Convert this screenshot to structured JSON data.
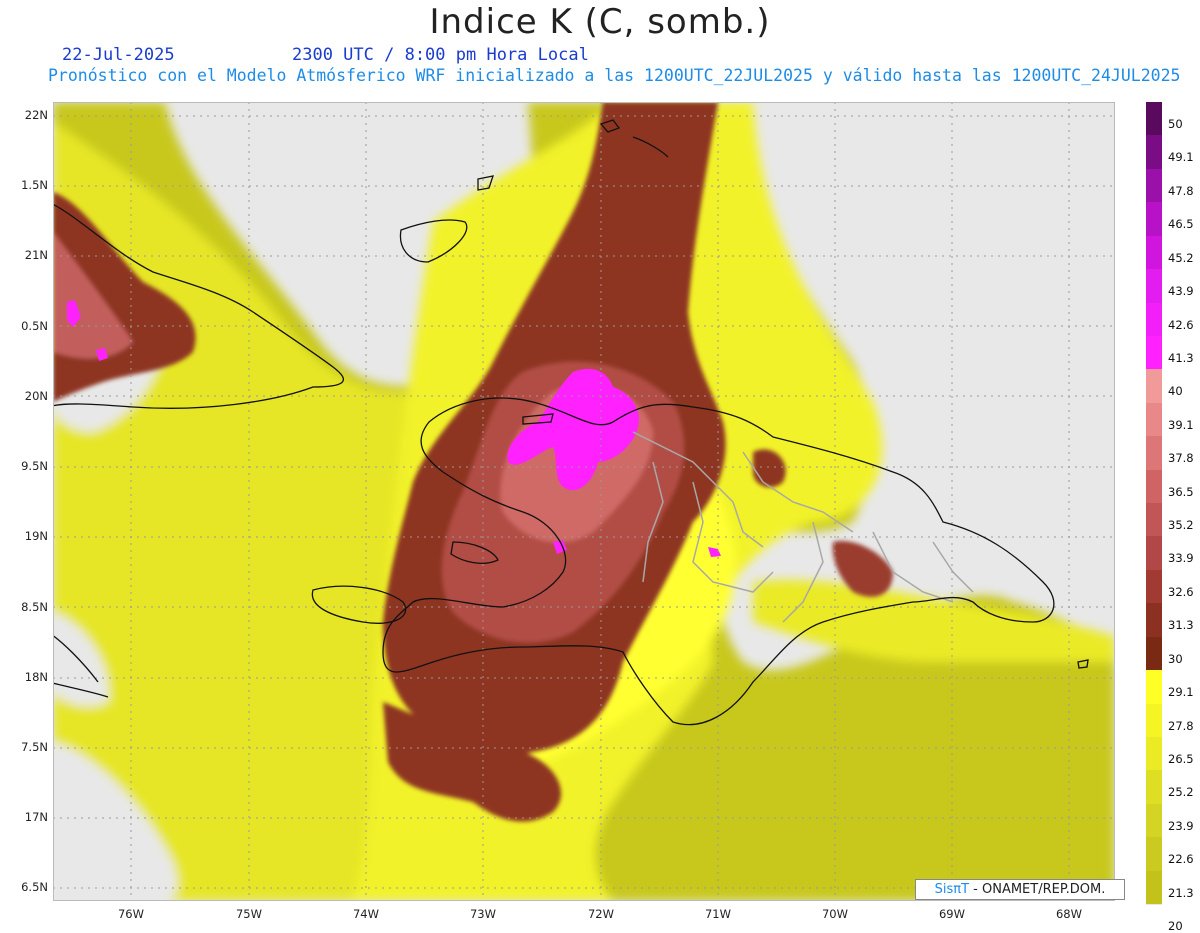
{
  "title": "Indice K (C, somb.)",
  "date": "22-Jul-2025",
  "time_label": "2300 UTC / 8:00 pm Hora Local",
  "subtitle": "Pronóstico con el Modelo Atmósferico WRF inicializado a las 1200UTC_22JUL2025 y válido hasta las  1200UTC_24JUL2025",
  "lat_labels": [
    "22N",
    "1.5N",
    "21N",
    "0.5N",
    "20N",
    "9.5N",
    "19N",
    "8.5N",
    "18N",
    "7.5N",
    "17N",
    "6.5N"
  ],
  "lon_labels": [
    "76W",
    "75W",
    "74W",
    "73W",
    "72W",
    "71W",
    "70W",
    "69W",
    "68W"
  ],
  "colorbar": {
    "labels": [
      "50",
      "49.1",
      "47.8",
      "46.5",
      "45.2",
      "43.9",
      "42.6",
      "41.3",
      "40",
      "39.1",
      "37.8",
      "36.5",
      "35.2",
      "33.9",
      "32.6",
      "31.3",
      "30",
      "29.1",
      "27.8",
      "26.5",
      "25.2",
      "23.9",
      "22.6",
      "21.3",
      "20"
    ],
    "colors": [
      "#5a0a5e",
      "#7a0d86",
      "#9a10a8",
      "#b812c8",
      "#d016de",
      "#e31cef",
      "#f21ff8",
      "#ff22ff",
      "#f09a9a",
      "#e88888",
      "#dd7676",
      "#d06464",
      "#c25555",
      "#b24747",
      "#a03a33",
      "#8c3122",
      "#7a2a12",
      "#ffff25",
      "#f5f525",
      "#eaea25",
      "#dede25",
      "#d4d425",
      "#caca20",
      "#c2c21a"
    ]
  },
  "credit": {
    "brand": "SisπT",
    "text": " - ONAMET/REP.DOM."
  }
}
